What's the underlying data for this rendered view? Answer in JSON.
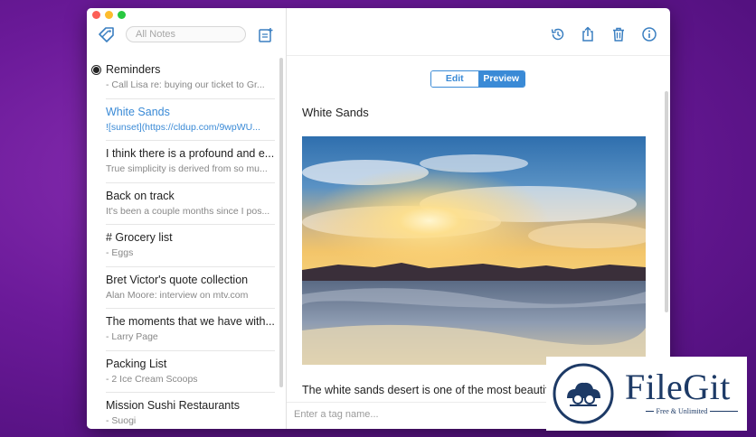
{
  "search": {
    "placeholder": "All Notes"
  },
  "notes": [
    {
      "title": "Reminders",
      "preview": "- Call Lisa re: buying our ticket to Gr..."
    },
    {
      "title": "White Sands",
      "preview": "![sunset](https://cldup.com/9wpWU..."
    },
    {
      "title": "I think there is a profound and e...",
      "preview": "True simplicity is derived from so mu..."
    },
    {
      "title": "Back on track",
      "preview": "It's been a couple months since I pos..."
    },
    {
      "title": "# Grocery list",
      "preview": "- Eggs"
    },
    {
      "title": "Bret Victor's quote collection",
      "preview": "Alan Moore: interview on mtv.com"
    },
    {
      "title": "The moments that we have with...",
      "preview": "- Larry Page"
    },
    {
      "title": "Packing List",
      "preview": "- 2 Ice Cream Scoops"
    },
    {
      "title": "Mission Sushi Restaurants",
      "preview": "- Suogi"
    }
  ],
  "editor": {
    "mode_edit": "Edit",
    "mode_preview": "Preview",
    "heading": "White Sands",
    "body": "The white sands desert is one of the most beautiful",
    "tag_placeholder": "Enter a tag name..."
  },
  "watermark": {
    "title": "FileGit",
    "subtitle": "Free & Unlimited"
  },
  "colors": {
    "accent": "#3a8ad6",
    "background": "#6b1a99",
    "watermark": "#1d3a66"
  },
  "icons": [
    "tags-icon",
    "new-note-icon",
    "history-icon",
    "share-icon",
    "trash-icon",
    "info-icon"
  ]
}
